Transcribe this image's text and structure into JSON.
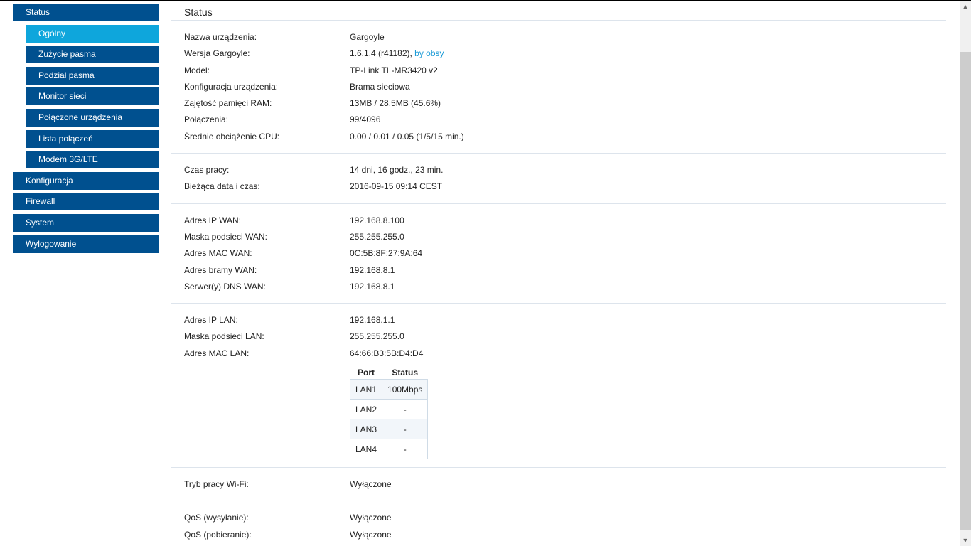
{
  "sidebar": {
    "items": [
      {
        "label": "Status",
        "sub": false,
        "active": false
      },
      {
        "label": "Ogólny",
        "sub": true,
        "active": true
      },
      {
        "label": "Zużycie pasma",
        "sub": true,
        "active": false
      },
      {
        "label": "Podział pasma",
        "sub": true,
        "active": false
      },
      {
        "label": "Monitor sieci",
        "sub": true,
        "active": false
      },
      {
        "label": "Połączone urządzenia",
        "sub": true,
        "active": false
      },
      {
        "label": "Lista połączeń",
        "sub": true,
        "active": false
      },
      {
        "label": "Modem 3G/LTE",
        "sub": true,
        "active": false
      },
      {
        "label": "Konfiguracja",
        "sub": false,
        "active": false
      },
      {
        "label": "Firewall",
        "sub": false,
        "active": false
      },
      {
        "label": "System",
        "sub": false,
        "active": false
      },
      {
        "label": "Wylogowanie",
        "sub": false,
        "active": false
      }
    ]
  },
  "main": {
    "title": "Status",
    "device": {
      "name_label": "Nazwa urządzenia:",
      "name_value": "Gargoyle",
      "version_label": "Wersja Gargoyle:",
      "version_value": "1.6.1.4 (r41182), ",
      "version_link": "by obsy",
      "model_label": "Model:",
      "model_value": "TP-Link TL-MR3420 v2",
      "config_label": "Konfiguracja urządzenia:",
      "config_value": "Brama sieciowa",
      "ram_label": "Zajętość pamięci RAM:",
      "ram_value": "13MB / 28.5MB (45.6%)",
      "conn_label": "Połączenia:",
      "conn_value": "99/4096",
      "cpu_label": "Średnie obciążenie CPU:",
      "cpu_value": "0.00 / 0.01 / 0.05  (1/5/15 min.)"
    },
    "time": {
      "uptime_label": "Czas pracy:",
      "uptime_value": "14 dni, 16 godz., 23 min.",
      "datetime_label": "Bieżąca data i czas:",
      "datetime_value": "2016-09-15 09:14 CEST"
    },
    "wan": {
      "ip_label": "Adres IP WAN:",
      "ip_value": "192.168.8.100",
      "mask_label": "Maska podsieci WAN:",
      "mask_value": "255.255.255.0",
      "mac_label": "Adres MAC WAN:",
      "mac_value": "0C:5B:8F:27:9A:64",
      "gw_label": "Adres bramy WAN:",
      "gw_value": "192.168.8.1",
      "dns_label": "Serwer(y) DNS WAN:",
      "dns_value": "192.168.8.1"
    },
    "lan": {
      "ip_label": "Adres IP LAN:",
      "ip_value": "192.168.1.1",
      "mask_label": "Maska podsieci LAN:",
      "mask_value": "255.255.255.0",
      "mac_label": "Adres MAC LAN:",
      "mac_value": "64:66:B3:5B:D4:D4",
      "ports": {
        "headers": [
          "Port",
          "Status"
        ],
        "rows": [
          [
            "LAN1",
            "100Mbps"
          ],
          [
            "LAN2",
            "-"
          ],
          [
            "LAN3",
            "-"
          ],
          [
            "LAN4",
            "-"
          ]
        ]
      }
    },
    "wifi": {
      "mode_label": "Tryb pracy Wi-Fi:",
      "mode_value": "Wyłączone"
    },
    "qos": {
      "up_label": "QoS (wysyłanie):",
      "up_value": "Wyłączone",
      "down_label": "QoS (pobieranie):",
      "down_value": "Wyłączone"
    }
  },
  "scrollbar": {
    "up_icon": "scroll-up-arrow",
    "down_icon": "scroll-down-arrow"
  }
}
